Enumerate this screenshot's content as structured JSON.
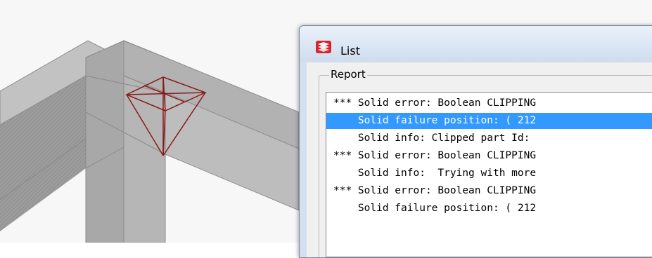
{
  "window": {
    "title": "List",
    "icon": "tekla-app-icon"
  },
  "report": {
    "group_label": "Report",
    "selected_index": 1,
    "rows": [
      "*** Solid error: Boolean CLIPPING",
      "    Solid failure position: ( 212",
      "    Solid info: Clipped part Id:",
      "*** Solid error: Boolean CLIPPING",
      "    Solid info:  Trying with more",
      "*** Solid error: Boolean CLIPPING",
      "    Solid failure position: ( 212"
    ]
  },
  "colors": {
    "selection": "#3399ff",
    "beam_fill": "#9a9a9a",
    "marker": "#8b1a1a"
  }
}
